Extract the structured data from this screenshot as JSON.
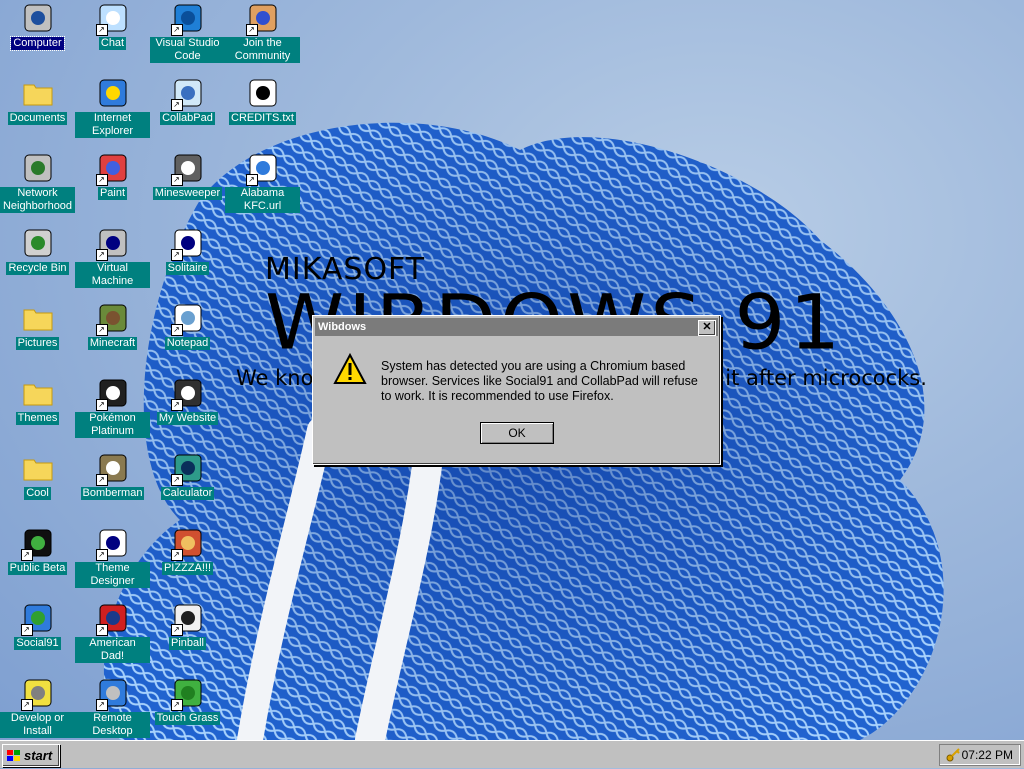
{
  "wallpaper": {
    "brand": "MIKASOFT",
    "title": "WIBDOWS 91",
    "slogan": "We know our products are trash so we named it after micrococks."
  },
  "desktop_icons": [
    {
      "label": "Computer",
      "icon": "computer-icon",
      "shortcut": false,
      "selected": true
    },
    {
      "label": "Chat",
      "icon": "chat-bubble-icon",
      "shortcut": true
    },
    {
      "label": "Visual Studio Code",
      "icon": "vscode-icon",
      "shortcut": true
    },
    {
      "label": "Join the Community",
      "icon": "community-icon",
      "shortcut": true
    },
    {
      "label": "Documents",
      "icon": "folder-icon",
      "shortcut": false
    },
    {
      "label": "Internet Explorer",
      "icon": "internet-explorer-icon",
      "shortcut": false
    },
    {
      "label": "CollabPad",
      "icon": "collabpad-icon",
      "shortcut": true
    },
    {
      "label": "CREDITS.txt",
      "icon": "text-file-icon",
      "shortcut": false
    },
    {
      "label": "Network Neighborhood",
      "icon": "network-icon",
      "shortcut": false
    },
    {
      "label": "Paint",
      "icon": "paint-icon",
      "shortcut": true
    },
    {
      "label": "Minesweeper",
      "icon": "minesweeper-icon",
      "shortcut": true
    },
    {
      "label": "Alabama KFC.url",
      "icon": "url-icon",
      "shortcut": true
    },
    {
      "label": "Recycle Bin",
      "icon": "recycle-bin-icon",
      "shortcut": false
    },
    {
      "label": "Virtual Machine",
      "icon": "virtual-machine-icon",
      "shortcut": true
    },
    {
      "label": "Solitaire",
      "icon": "solitaire-icon",
      "shortcut": true
    },
    {
      "label": "Pictures",
      "icon": "folder-icon",
      "shortcut": false
    },
    {
      "label": "Minecraft",
      "icon": "minecraft-icon",
      "shortcut": true
    },
    {
      "label": "Notepad",
      "icon": "notepad-icon",
      "shortcut": true
    },
    {
      "label": "Themes",
      "icon": "folder-icon",
      "shortcut": false
    },
    {
      "label": "Pokémon Platinum",
      "icon": "pokemon-icon",
      "shortcut": true
    },
    {
      "label": "My Website",
      "icon": "website-icon",
      "shortcut": true
    },
    {
      "label": "Cool",
      "icon": "folder-icon",
      "shortcut": false
    },
    {
      "label": "Bomberman",
      "icon": "bomberman-icon",
      "shortcut": true
    },
    {
      "label": "Calculator",
      "icon": "calculator-icon",
      "shortcut": true
    },
    {
      "label": "Public Beta",
      "icon": "public-beta-icon",
      "shortcut": true
    },
    {
      "label": "Theme Designer",
      "icon": "theme-designer-icon",
      "shortcut": true
    },
    {
      "label": "PIZZZA!!!",
      "icon": "pizza-icon",
      "shortcut": true
    },
    {
      "label": "Social91",
      "icon": "globe-icon",
      "shortcut": true
    },
    {
      "label": "American Dad!",
      "icon": "american-flag-icon",
      "shortcut": true
    },
    {
      "label": "Pinball",
      "icon": "pinball-icon",
      "shortcut": true
    },
    {
      "label": "Develop or Install",
      "icon": "develop-icon",
      "shortcut": true
    },
    {
      "label": "Remote Desktop",
      "icon": "remote-desktop-icon",
      "shortcut": true
    },
    {
      "label": "Touch Grass",
      "icon": "grass-icon",
      "shortcut": true
    }
  ],
  "dialog": {
    "title": "Wibdows",
    "close_glyph": "✕",
    "icon": "warning-icon",
    "message": "System has detected you are using a Chromium based browser. Services like Social91 and CollabPad will refuse to work. It is recommended to use Firefox.",
    "ok_label": "OK"
  },
  "taskbar": {
    "start_label": "start",
    "tray_icon": "key-icon",
    "clock": "07:22 PM"
  },
  "colors": {
    "desktop_label_bg": "#00807f",
    "dialog_titlebar": "#7b7b7b",
    "chrome": "#c0c0c0"
  }
}
